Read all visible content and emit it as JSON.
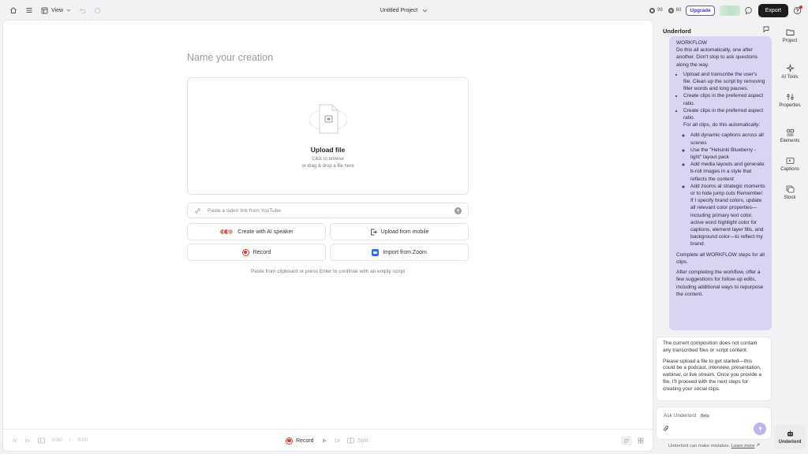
{
  "topbar": {
    "view_label": "View",
    "project_title": "Untitled Project",
    "credits": [
      {
        "icon": "media-credit-icon",
        "value": "99"
      },
      {
        "icon": "ai-credit-icon",
        "value": "60"
      }
    ],
    "upgrade_label": "Upgrade",
    "export_label": "Export"
  },
  "main": {
    "name_placeholder": "Name your creation",
    "upload": {
      "title": "Upload file",
      "line1": "Click to browse",
      "line2": "or drag & drop a file here"
    },
    "link_placeholder": "Paste a video link from YouTube",
    "actions": {
      "ai_speaker": "Create with AI speaker",
      "upload_mobile": "Upload from mobile",
      "record": "Record",
      "zoom": "Import from Zoom"
    },
    "paste_hint": "Paste from clipboard or press Enter to continue with an empty script"
  },
  "bottombar": {
    "time_current": "0:00",
    "time_sep": "/",
    "time_total": "0:00",
    "record_label": "Record",
    "speed_label": "1x",
    "split_label": "Split"
  },
  "chat": {
    "title": "Underlord",
    "user_message": {
      "heading": "WORKFLOW",
      "intro": "Do this all automatically, one after another. Don't stop to ask questions along the way.",
      "steps": [
        "Upload and transcribe the user's file. Clean up the script by removing filler words and long pauses.",
        "Create clips in the preferred aspect ratio.",
        "Create clips in the preferred aspect ratio."
      ],
      "all_clips_intro": "For all clips, do this automatically:",
      "substeps": [
        "Add dynamic captions across all scenes",
        "Use the \"Helsinki Blueberry - light\" layout pack",
        "Add media layouts and generate b-roll images in a style that reflects the content",
        "Add zooms at strategic moments or to hide jump cuts Remember: If I specify brand colors, update all relevant color properties—including primary text color, active word highlight color for captions, element layer fills, and background color—to reflect my brand."
      ],
      "complete": "Complete all WORKFLOW steps for all clips.",
      "after": "After completing the workflow, offer a few suggestions for follow-up edits, including additional ways to repurpose the content."
    },
    "ai_message": {
      "p1": "The current composition does not contain any transcribed files or script content.",
      "p2": "Please upload a file to get started—this could be a podcast, interview, presentation, webinar, or live stream. Once you provide a file, I'll proceed with the next steps for creating your social clips."
    },
    "ask_placeholder": "Ask Underlord",
    "beta_label": "Beta",
    "disclaimer": "Underlord can make mistakes.",
    "learn_more": "Learn more"
  },
  "rail": [
    {
      "label": "Project",
      "icon": "folder-icon"
    },
    {
      "label": "AI Tools",
      "icon": "sparkle-icon"
    },
    {
      "label": "Properties",
      "icon": "sliders-icon"
    },
    {
      "label": "Elements",
      "icon": "shapes-icon"
    },
    {
      "label": "Captions",
      "icon": "captions-icon"
    },
    {
      "label": "Stock",
      "icon": "stock-icon"
    },
    {
      "label": "Underlord",
      "icon": "robot-icon"
    }
  ],
  "colors": {
    "accent": "#6b4de0",
    "user_bubble": "#d8d5f2",
    "record_red": "#d83a34",
    "zoom_blue": "#2d6ee9",
    "export_bg": "#1c1c1f"
  }
}
